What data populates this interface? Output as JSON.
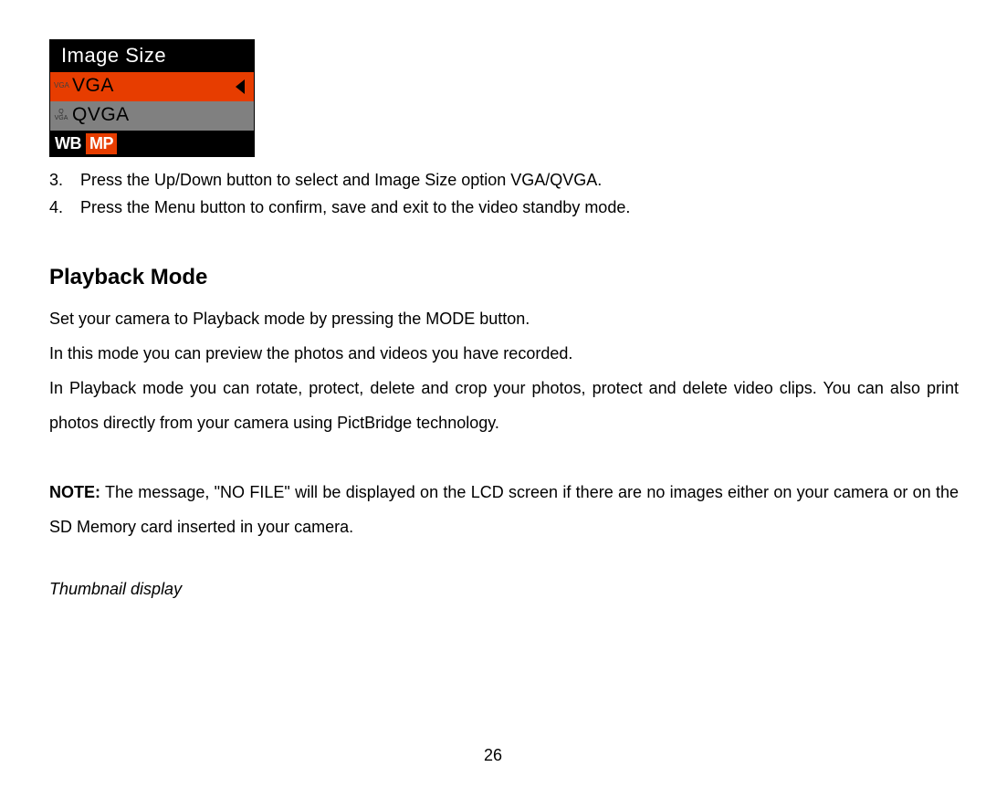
{
  "widget": {
    "title": "Image  Size",
    "option1_tag": "VGA",
    "option1_text": "VGA",
    "option2_tag_top": "Q",
    "option2_tag_bottom": "VGA",
    "option2_text": "QVGA",
    "footer_wb": "WB",
    "footer_mp": "MP"
  },
  "steps": {
    "num3": "3.",
    "text3": "Press the Up/Down button to select and Image Size option VGA/QVGA.",
    "num4": "4.",
    "text4": "Press the Menu button to confirm, save and exit to the video standby mode."
  },
  "section": {
    "heading": "Playback Mode",
    "p1": "Set your camera to Playback mode by pressing the MODE button.",
    "p2": "In this mode you can preview the photos and videos you have recorded.",
    "p3": "In Playback mode you can rotate, protect, delete and crop your photos, protect and delete video clips. You can also print photos directly from your camera using PictBridge technology.",
    "note_label": "NOTE:",
    "note_text": " The message, \"NO FILE\" will be displayed on the LCD screen if there are no images either on your camera or on the SD Memory card inserted in your camera.",
    "subheading": "Thumbnail display"
  },
  "page_number": "26"
}
